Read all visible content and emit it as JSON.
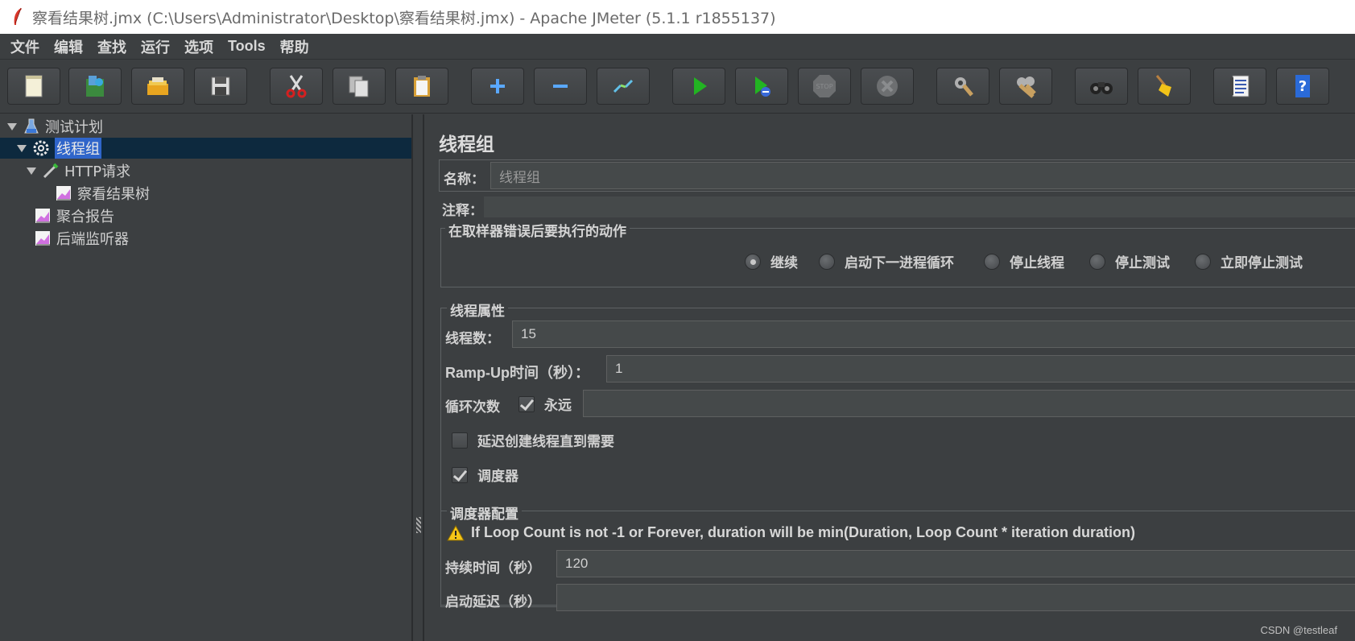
{
  "window": {
    "title": "察看结果树.jmx (C:\\Users\\Administrator\\Desktop\\察看结果树.jmx) - Apache JMeter (5.1.1 r1855137)"
  },
  "menu": {
    "items": [
      "文件",
      "编辑",
      "查找",
      "运行",
      "选项",
      "Tools",
      "帮助"
    ]
  },
  "toolbar": {
    "buttons": [
      {
        "icon": "new-document-icon"
      },
      {
        "icon": "templates-icon"
      },
      {
        "icon": "open-folder-icon"
      },
      {
        "icon": "save-icon"
      },
      {
        "icon": "cut-icon"
      },
      {
        "icon": "copy-icon"
      },
      {
        "icon": "paste-icon"
      },
      {
        "icon": "expand-plus-icon"
      },
      {
        "icon": "collapse-minus-icon"
      },
      {
        "icon": "toggle-icon"
      },
      {
        "icon": "start-icon"
      },
      {
        "icon": "start-no-pause-icon"
      },
      {
        "icon": "stop-icon"
      },
      {
        "icon": "shutdown-icon"
      },
      {
        "icon": "clear-icon"
      },
      {
        "icon": "clear-all-icon"
      },
      {
        "icon": "search-binoculars-icon"
      },
      {
        "icon": "reset-search-broom-icon"
      },
      {
        "icon": "function-helper-icon"
      },
      {
        "icon": "help-icon"
      }
    ]
  },
  "tree": {
    "items": [
      {
        "label": "测试计划",
        "icon": "test-plan-flask-icon"
      },
      {
        "label": "线程组",
        "icon": "thread-group-gear-icon"
      },
      {
        "label": "HTTP请求",
        "icon": "http-sampler-pipette-icon"
      },
      {
        "label": "察看结果树",
        "icon": "listener-chart-icon"
      },
      {
        "label": "聚合报告",
        "icon": "listener-chart-icon"
      },
      {
        "label": "后端监听器",
        "icon": "listener-chart-icon"
      }
    ]
  },
  "main": {
    "title": "线程组",
    "name_label": "名称：",
    "name_value": "线程组",
    "comment_label": "注释：",
    "error_action": {
      "title": "在取样器错误后要执行的动作",
      "options": [
        "继续",
        "启动下一进程循环",
        "停止线程",
        "停止测试",
        "立即停止测试"
      ],
      "selected": "继续"
    },
    "thread_props": {
      "title": "线程属性",
      "threads_label": "线程数：",
      "threads_value": "15",
      "rampup_label": "Ramp-Up时间（秒）：",
      "rampup_value": "1",
      "loop_label": "循环次数",
      "forever_label": "永远",
      "forever_checked": true,
      "delay_label": "延迟创建线程直到需要",
      "delay_checked": false,
      "scheduler_label": "调度器",
      "scheduler_checked": true
    },
    "scheduler": {
      "title": "调度器配置",
      "warning": "If Loop Count is not -1 or Forever, duration will be min(Duration, Loop Count * iteration duration)",
      "duration_label": "持续时间（秒）",
      "duration_value": "120",
      "delay_label": "启动延迟（秒）",
      "delay_value": ""
    }
  },
  "watermark": "CSDN @testleaf"
}
